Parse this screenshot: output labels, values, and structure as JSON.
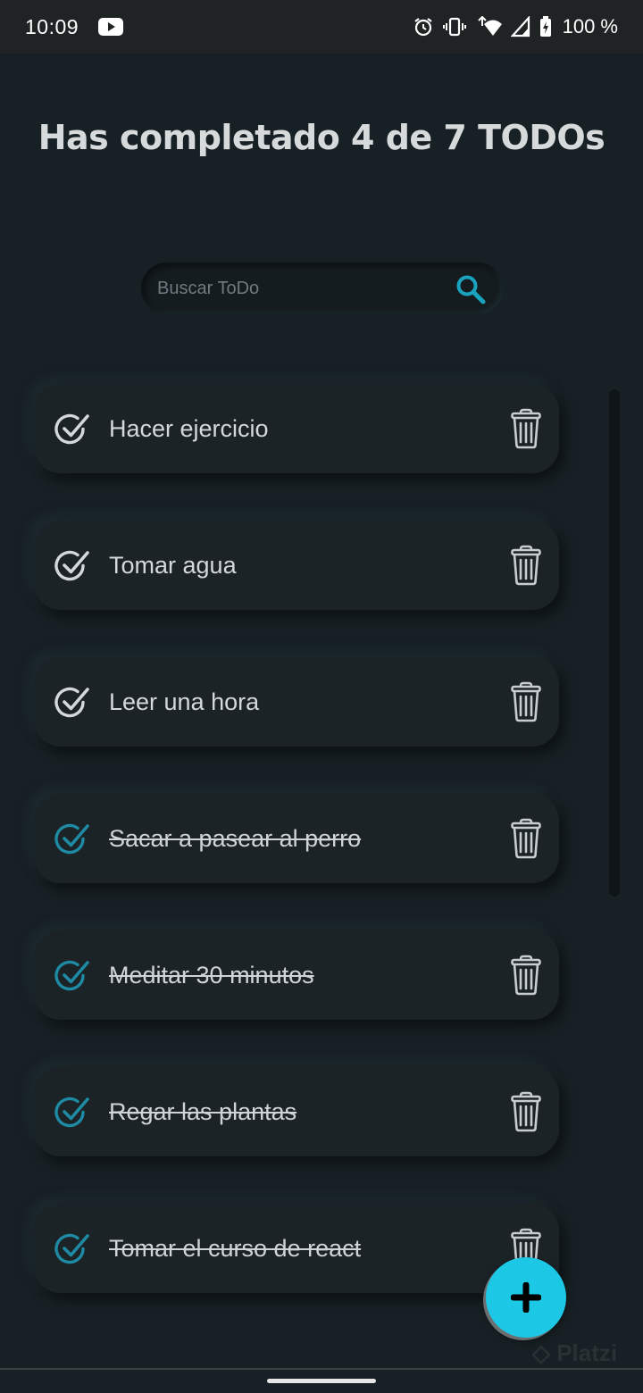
{
  "status_bar": {
    "time": "10:09",
    "battery": "100 %",
    "icons": [
      "youtube-icon",
      "alarm-icon",
      "vibrate-icon",
      "wifi-icon",
      "signal-icon",
      "battery-icon"
    ]
  },
  "title": "Has completado 4 de 7 TODOs",
  "search": {
    "placeholder": "Buscar ToDo",
    "value": ""
  },
  "todos": [
    {
      "text": "Hacer ejercicio",
      "completed": false
    },
    {
      "text": "Tomar agua",
      "completed": false
    },
    {
      "text": "Leer una hora",
      "completed": false
    },
    {
      "text": "Sacar a pasear al perro",
      "completed": true
    },
    {
      "text": "Meditar 30 minutos",
      "completed": true
    },
    {
      "text": "Regar las plantas",
      "completed": true
    },
    {
      "text": "Tomar el curso de react",
      "completed": true
    }
  ],
  "fab": {
    "icon": "plus-icon"
  },
  "colors": {
    "background": "#172024",
    "accent": "#1cc8e6",
    "check_done": "#1e8aa3",
    "check_pending": "#d4d8da",
    "text": "#d4d8da"
  }
}
